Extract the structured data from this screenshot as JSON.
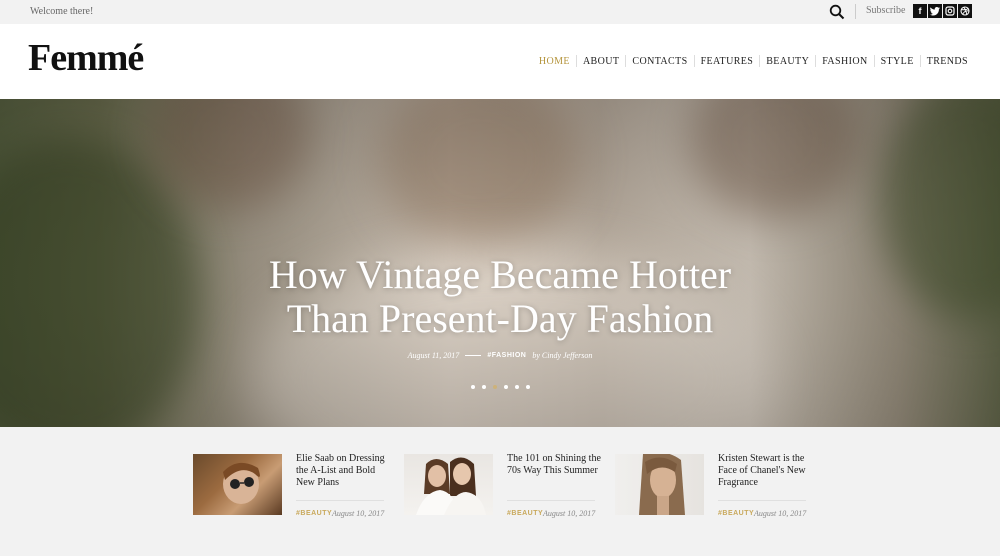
{
  "topbar": {
    "welcome": "Welcome there!",
    "subscribe": "Subscribe",
    "social": [
      {
        "icon": "facebook-icon",
        "glyph": "f"
      },
      {
        "icon": "twitter-icon",
        "glyph": "t"
      },
      {
        "icon": "instagram-icon",
        "glyph": "◎"
      },
      {
        "icon": "dribbble-icon",
        "glyph": "⊛"
      }
    ]
  },
  "header": {
    "logo": "Femmé",
    "nav": [
      "HOME",
      "ABOUT",
      "CONTACTS",
      "FEATURES",
      "BEAUTY",
      "FASHION",
      "STYLE",
      "TRENDS"
    ],
    "active_index": 0
  },
  "hero": {
    "title_line1": "How Vintage Became Hotter",
    "title_line2": "Than Present-Day Fashion",
    "date": "August 11, 2017",
    "tag": "#FASHION",
    "author": "by Cindy Jefferson",
    "slide_count": 6,
    "active_slide": 2
  },
  "posts": [
    {
      "title": "Elie Saab on Dressing the A-List and Bold New Plans",
      "tag": "#BEAUTY",
      "date": "August 10, 2017"
    },
    {
      "title": "The 101 on Shining the 70s Way This Summer",
      "tag": "#BEAUTY",
      "date": "August 10, 2017"
    },
    {
      "title": "Kristen Stewart is the Face of Chanel's New Fragrance",
      "tag": "#BEAUTY",
      "date": "August 10, 2017"
    }
  ],
  "colors": {
    "accent": "#b5953d",
    "tag": "#c9a95c",
    "dark": "#111111"
  }
}
